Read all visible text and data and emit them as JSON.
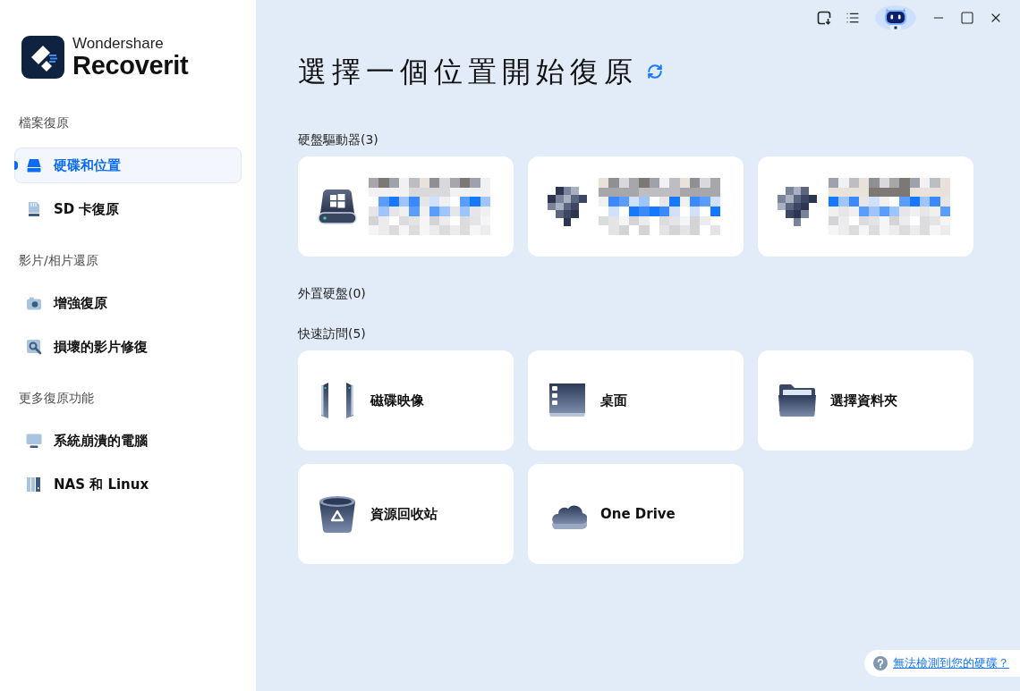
{
  "sidebar": {
    "logo": {
      "brand": "Wondershare",
      "product": "Recoverit"
    },
    "sections": [
      {
        "heading": "檔案復原",
        "items": [
          {
            "label": "硬碟和位置",
            "kind": "drive",
            "selected": true
          },
          {
            "label": "SD 卡復原",
            "kind": "sd-card",
            "selected": false
          }
        ]
      },
      {
        "heading": "影片/相片還原",
        "items": [
          {
            "label": "增強復原",
            "kind": "camera",
            "selected": false
          },
          {
            "label": "損壞的影片修復",
            "kind": "video-repair",
            "selected": false
          }
        ]
      },
      {
        "heading": "更多復原功能",
        "items": [
          {
            "label": "系統崩潰的電腦",
            "kind": "monitor",
            "selected": false
          },
          {
            "label": "NAS 和 Linux",
            "kind": "nas",
            "selected": false
          }
        ]
      }
    ]
  },
  "main": {
    "title": "選擇一個位置開始復原",
    "hard_drives": {
      "heading": "硬盤驅動器(3)",
      "cards": [
        {
          "kind": "system-drive"
        },
        {
          "kind": "redacted"
        },
        {
          "kind": "redacted"
        }
      ]
    },
    "external_drives": {
      "heading": "外置硬盤(0)"
    },
    "quick_access": {
      "heading": "快速訪問(5)",
      "items": [
        {
          "label": "磁碟映像",
          "kind": "disk-image"
        },
        {
          "label": "桌面",
          "kind": "desktop"
        },
        {
          "label": "選擇資料夾",
          "kind": "folder"
        },
        {
          "label": "資源回收站",
          "kind": "recycle-bin"
        },
        {
          "label": "One Drive",
          "kind": "cloud"
        }
      ]
    }
  },
  "help_link": {
    "label": "無法檢測到您的硬碟？"
  }
}
